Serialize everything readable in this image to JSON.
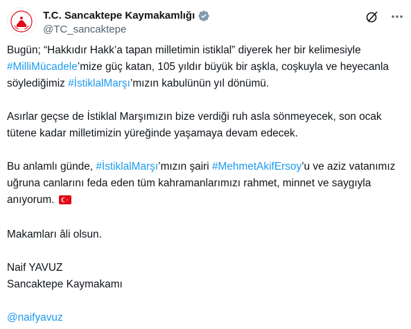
{
  "account": {
    "display_name": "T.C. Sancaktepe Kaymakamlığı",
    "handle": "@TC_sancaktepe"
  },
  "icons": {
    "verified": "verified-badge-icon",
    "grok": "grok-icon",
    "more": "more-options-icon",
    "flag": "turkey-flag-icon",
    "avatar": "emblem-logo"
  },
  "colors": {
    "link": "#1d9bf0",
    "text": "#0f1419",
    "muted": "#536471",
    "verified": "#829aab",
    "flag": "#e30a17"
  },
  "tweet": {
    "p1": {
      "t1": "Bugün; “Hakkıdır Hakk’a tapan milletimin istiklal” diyerek her bir kelimesiyle",
      "tag1": "#MilliMücadele",
      "t2": "’mize güç katan, 105 yıldır büyük bir aşkla, coşkuyla ve",
      "t3": "heyecanla söylediğimiz",
      "tag2": "#İstiklalMarşı",
      "t4": "’mızın kabulünün yıl dönümü."
    },
    "p2": {
      "t1": "Asırlar geçse de İstiklal Marşımızın bize verdiği ruh asla sönmeyecek, son",
      "t2": "ocak tütene kadar milletimizin yüreğinde yaşamaya devam edecek."
    },
    "p3": {
      "t1": "Bu anlamlı günde,",
      "tag1": "#İstiklalMarşı",
      "t2": "’mızın şairi",
      "tag2": "#MehmetAkifErsoy",
      "t3": "’u ve aziz",
      "t4": "vatanımız uğruna canlarını feda eden tüm kahramanlarımızı rahmet, minnet",
      "t5": "ve saygıyla anıyorum."
    },
    "p4": "Makamları âli olsun.",
    "p5": {
      "name": "Naif YAVUZ",
      "title": "Sancaktepe Kaymakamı"
    },
    "mention": "@naifyavuz"
  }
}
